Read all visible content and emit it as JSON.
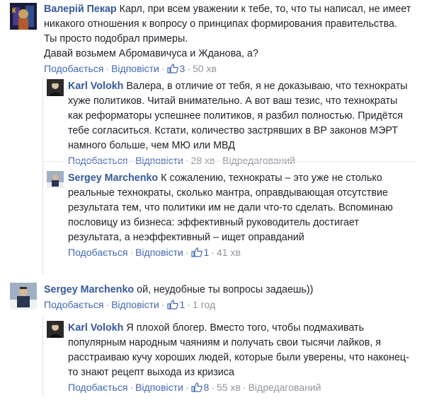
{
  "comments": [
    {
      "author": "Валерій Пекар",
      "text": "Карл, при всем уважении к тебе, то, что ты написал, не имеет никакого отношения к вопросу о принципах формирования правительства. Ты просто подобрал примеры.\nДавай возьмем Абромавичуса и Жданова, а?",
      "share": "Подобається",
      "reply": "Відповісти",
      "likes": "3",
      "time": "50 хв",
      "edited": ""
    },
    {
      "author": "Karl Volokh",
      "text": "Валера, в отличие от тебя, я не доказываю, что технократы хуже политиков. Читай внимательно. А вот ваш тезис, что технократы как реформаторы успешнее политиков, я разбил полностью. Придётся тебе согласиться. Кстати, количество застрявших в ВР законов МЭРТ намного больше, чем МЮ или МВД",
      "share": "Подобається",
      "reply": "Відповісти",
      "likes": "",
      "time": "28 хв",
      "edited": "Відредагований"
    },
    {
      "author": "Sergey Marchenko",
      "text": "К сожалению, технократы – это уже не столько реальные технократы, сколько мантра, оправдывающая отсутствие результата тем, что политики им не дали что-то сделать. Вспоминаю пословицу из бизнеса: эффективный руководитель достигает результата, а неэффективный – ищет оправданий",
      "share": "Подобається",
      "reply": "Відповісти",
      "likes": "1",
      "time": "41 хв",
      "edited": ""
    },
    {
      "author": "Sergey Marchenko",
      "text": "ой, неудобные ты вопросы задаешь))",
      "share": "Подобається",
      "reply": "Відповісти",
      "likes": "1",
      "time": "1 год",
      "edited": ""
    },
    {
      "author": "Karl Volokh",
      "text": "Я плохой блогер. Вместо того, чтобы подмахивать популярным народным чаяниям и получать свои тысячи лайков, я расстраиваю кучу хороших людей, которые были уверены, что наконец-то знают рецепт выхода из кризиса",
      "share": "Подобається",
      "reply": "Відповісти",
      "likes": "8",
      "time": "55 хв",
      "edited": "Відредагований"
    }
  ],
  "colors": {
    "author": "#365899",
    "link": "#4267b2",
    "muted": "#90949c",
    "text": "#1d2129"
  }
}
